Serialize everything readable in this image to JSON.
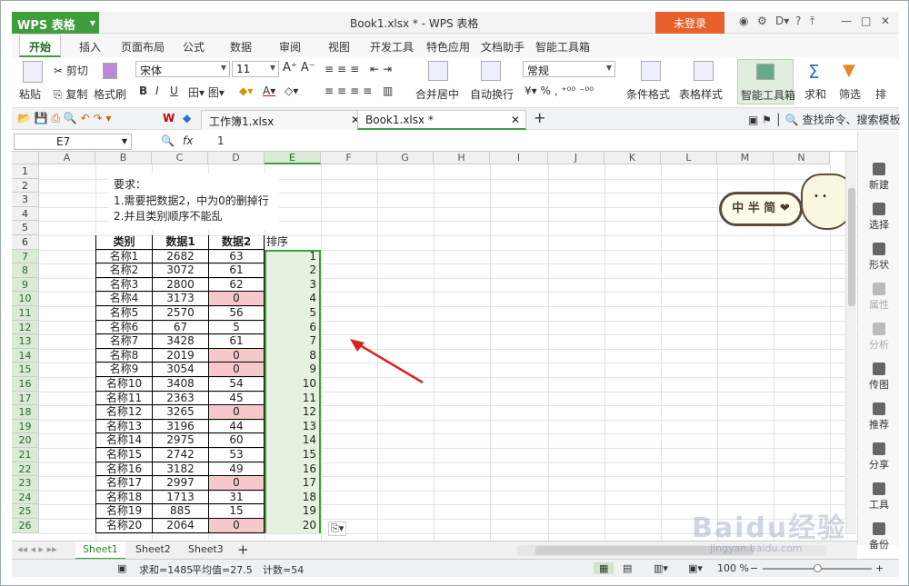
{
  "titlebar": {
    "app": "WPS 表格",
    "doc_title": "Book1.xlsx * - WPS 表格",
    "login": "未登录",
    "controls": [
      "?",
      "—",
      "□",
      "✕"
    ]
  },
  "menu": [
    "开始",
    "插入",
    "页面布局",
    "公式",
    "数据",
    "审阅",
    "视图",
    "开发工具",
    "特色应用",
    "文档助手",
    "智能工具箱"
  ],
  "ribbon": {
    "paste": "粘贴",
    "cut": "剪切",
    "copy": "复制",
    "format_painter": "格式刷",
    "font": "宋体",
    "size": "11",
    "merge": "合并居中",
    "wrap": "自动换行",
    "number_format": "常规",
    "cond_format": "条件格式",
    "table_style": "表格样式",
    "smart": "智能工具箱",
    "sum": "求和",
    "filter": "筛选",
    "sort": "排"
  },
  "file_tabs": [
    {
      "label": "工作簿1.xlsx",
      "active": false
    },
    {
      "label": "Book1.xlsx *",
      "active": true
    }
  ],
  "search_placeholder": "查找命令、搜索模板",
  "formula": {
    "cell_ref": "E7",
    "fx": "fx",
    "value": "1"
  },
  "columns": [
    "A",
    "B",
    "C",
    "D",
    "E",
    "F",
    "G",
    "H",
    "I",
    "J",
    "K",
    "L",
    "M",
    "N"
  ],
  "rows": [
    "1",
    "2",
    "3",
    "4",
    "5",
    "6",
    "7",
    "8",
    "9",
    "10",
    "11",
    "12",
    "13",
    "14",
    "15",
    "16",
    "17",
    "18",
    "19",
    "20",
    "21",
    "22",
    "23",
    "24",
    "25",
    "26"
  ],
  "note": [
    "要求：",
    "1.需要把数据2，中为0的删掉行",
    "2.并且类别顺序不能乱"
  ],
  "table": {
    "headers": [
      "类别",
      "数据1",
      "数据2",
      "排序"
    ],
    "rows": [
      [
        "名称1",
        "2682",
        "63",
        "1"
      ],
      [
        "名称2",
        "3072",
        "61",
        "2"
      ],
      [
        "名称3",
        "2800",
        "62",
        "3"
      ],
      [
        "名称4",
        "3173",
        "0",
        "4"
      ],
      [
        "名称5",
        "2570",
        "56",
        "5"
      ],
      [
        "名称6",
        "67",
        "5",
        "6"
      ],
      [
        "名称7",
        "3428",
        "61",
        "7"
      ],
      [
        "名称8",
        "2019",
        "0",
        "8"
      ],
      [
        "名称9",
        "3054",
        "0",
        "9"
      ],
      [
        "名称10",
        "3408",
        "54",
        "10"
      ],
      [
        "名称11",
        "2363",
        "45",
        "11"
      ],
      [
        "名称12",
        "3265",
        "0",
        "12"
      ],
      [
        "名称13",
        "3196",
        "44",
        "13"
      ],
      [
        "名称14",
        "2975",
        "60",
        "14"
      ],
      [
        "名称15",
        "2742",
        "53",
        "15"
      ],
      [
        "名称16",
        "3182",
        "49",
        "16"
      ],
      [
        "名称17",
        "2997",
        "0",
        "17"
      ],
      [
        "名称18",
        "1713",
        "31",
        "18"
      ],
      [
        "名称19",
        "885",
        "15",
        "19"
      ],
      [
        "名称20",
        "2064",
        "0",
        "20"
      ]
    ]
  },
  "sticker": "中 半 简 ❤",
  "sidebar": [
    {
      "label": "新建",
      "dim": false
    },
    {
      "label": "选择",
      "dim": false
    },
    {
      "label": "形状",
      "dim": false
    },
    {
      "label": "属性",
      "dim": true
    },
    {
      "label": "分析",
      "dim": true
    },
    {
      "label": "传图",
      "dim": false
    },
    {
      "label": "推荐",
      "dim": false
    },
    {
      "label": "分享",
      "dim": false
    },
    {
      "label": "工具",
      "dim": false
    },
    {
      "label": "备份",
      "dim": false
    }
  ],
  "sheets": [
    "Sheet1",
    "Sheet2",
    "Sheet3"
  ],
  "status": {
    "sum": "求和=1485",
    "avg": "平均值=27.5",
    "count": "计数=54",
    "zoom": "100 %"
  },
  "watermark": {
    "logo": "Baidu经验",
    "url": "jingyan.baidu.com"
  },
  "colors": {
    "accent": "#3e9e3e",
    "login": "#e8602b",
    "zero_highlight": "#f6c8cc"
  }
}
